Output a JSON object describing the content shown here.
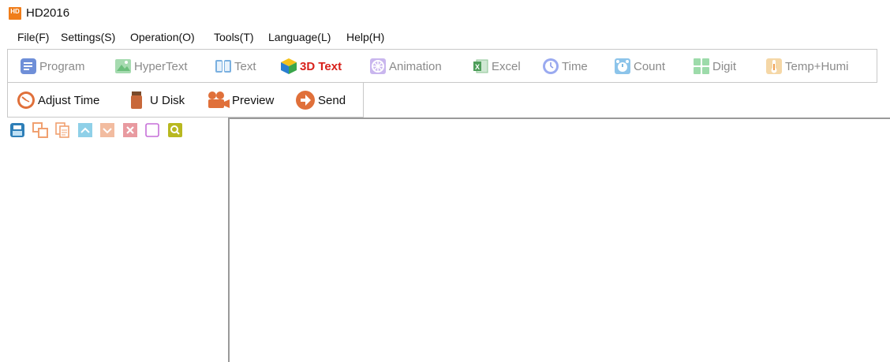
{
  "window": {
    "title": "HD2016",
    "logo_text": "HD"
  },
  "menu": [
    {
      "label": "File(F)"
    },
    {
      "label": "Settings(S)"
    },
    {
      "label": "Operation(O)"
    },
    {
      "label": "Tools(T)"
    },
    {
      "label": "Language(L)"
    },
    {
      "label": "Help(H)"
    }
  ],
  "toolbar_main": [
    {
      "label": "Program",
      "icon": "program-icon",
      "color": "#6f8fd8"
    },
    {
      "label": "HyperText",
      "icon": "hypertext-icon",
      "color": "#7cc486"
    },
    {
      "label": "Text",
      "icon": "text-icon",
      "color": "#7ab0e0"
    },
    {
      "label": "3D Text",
      "icon": "3d-text-icon",
      "color": "#d8211b"
    },
    {
      "label": "Animation",
      "icon": "animation-icon",
      "color": "#b59be0"
    },
    {
      "label": "Excel",
      "icon": "excel-icon",
      "color": "#4e9e5a"
    },
    {
      "label": "Time",
      "icon": "time-icon",
      "color": "#8a9be8"
    },
    {
      "label": "Count",
      "icon": "count-icon",
      "color": "#5fa9d9"
    },
    {
      "label": "Digit",
      "icon": "digit-icon",
      "color": "#7fcf8f"
    },
    {
      "label": "Temp+Humi",
      "icon": "temp-humi-icon",
      "color": "#f0c78a"
    }
  ],
  "toolbar_secondary": [
    {
      "label": "Adjust Time",
      "icon": "adjust-time-icon",
      "color": "#e0703a"
    },
    {
      "label": "U Disk",
      "icon": "u-disk-icon",
      "color": "#d0703a"
    },
    {
      "label": "Preview",
      "icon": "preview-icon",
      "color": "#e0703a"
    },
    {
      "label": "Send",
      "icon": "send-icon",
      "color": "#e0703a"
    }
  ],
  "program_tools": [
    {
      "icon": "save-icon",
      "color": "#2e7fb8"
    },
    {
      "icon": "copy-icon",
      "color": "#f0a070"
    },
    {
      "icon": "paste-icon",
      "color": "#f0a070"
    },
    {
      "icon": "move-up-icon",
      "color": "#8fd0e8"
    },
    {
      "icon": "move-down-icon",
      "color": "#f2bca0"
    },
    {
      "icon": "delete-icon",
      "color": "#e89aa0"
    },
    {
      "icon": "blank-icon",
      "color": "#c66fd8"
    },
    {
      "icon": "search-icon",
      "color": "#b8b820"
    }
  ]
}
